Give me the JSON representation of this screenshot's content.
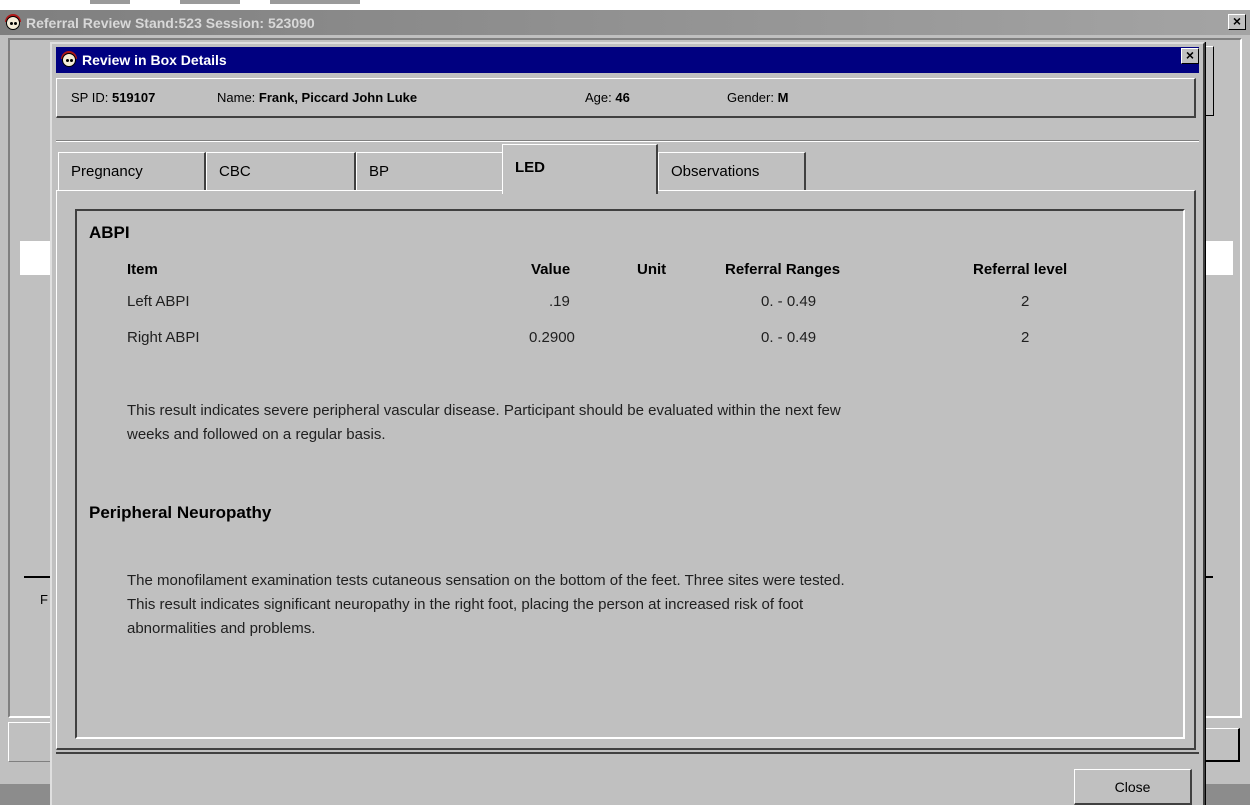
{
  "outer_window": {
    "title": "Referral Review Stand:523 Session: 523090"
  },
  "dialog": {
    "title": "Review in Box Details",
    "close_glyph": "×"
  },
  "info": {
    "spid_label": "SP ID:",
    "spid_value": "519107",
    "name_label": "Name:",
    "name_value": "Frank, Piccard John Luke",
    "age_label": "Age:",
    "age_value": "46",
    "gender_label": "Gender:",
    "gender_value": "M"
  },
  "tabs": [
    {
      "label": "Pregnancy"
    },
    {
      "label": "CBC"
    },
    {
      "label": "BP"
    },
    {
      "label": "LED"
    },
    {
      "label": "Observations"
    }
  ],
  "active_tab": "LED",
  "abpi": {
    "title": "ABPI",
    "headers": {
      "item": "Item",
      "value": "Value",
      "unit": "Unit",
      "ranges": "Referral Ranges",
      "level": "Referral level"
    },
    "rows": [
      {
        "item": "Left ABPI",
        "value": ".19",
        "unit": "",
        "ranges": "0. - 0.49",
        "level": "2"
      },
      {
        "item": "Right ABPI",
        "value": "0.2900",
        "unit": "",
        "ranges": "0. - 0.49",
        "level": "2"
      }
    ],
    "result_text_line1": "This result indicates severe peripheral vascular disease. Participant should be evaluated within the next few",
    "result_text_line2": "weeks and followed on a regular basis."
  },
  "neuropathy": {
    "title": "Peripheral Neuropathy",
    "text_line1": "The monofilament examination tests cutaneous sensation on the bottom of the feet. Three sites were tested.",
    "text_line2": "This result indicates significant neuropathy in the right foot, placing the person at increased risk of foot",
    "text_line3": "abnormalities and problems."
  },
  "buttons": {
    "close_label": "Close"
  },
  "background_fragment": "F"
}
